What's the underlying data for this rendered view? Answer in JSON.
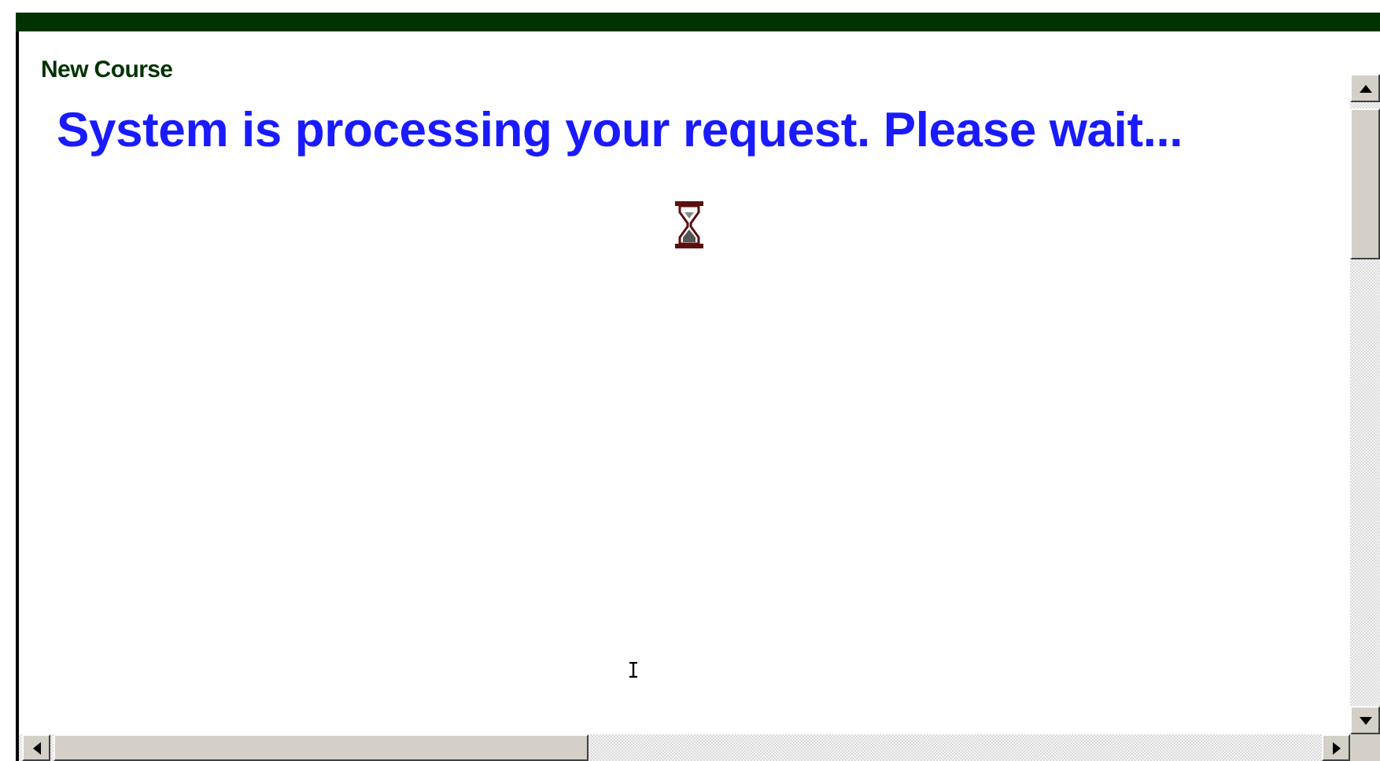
{
  "page": {
    "heading": "New Course",
    "message": "System is processing your request. Please wait..."
  }
}
